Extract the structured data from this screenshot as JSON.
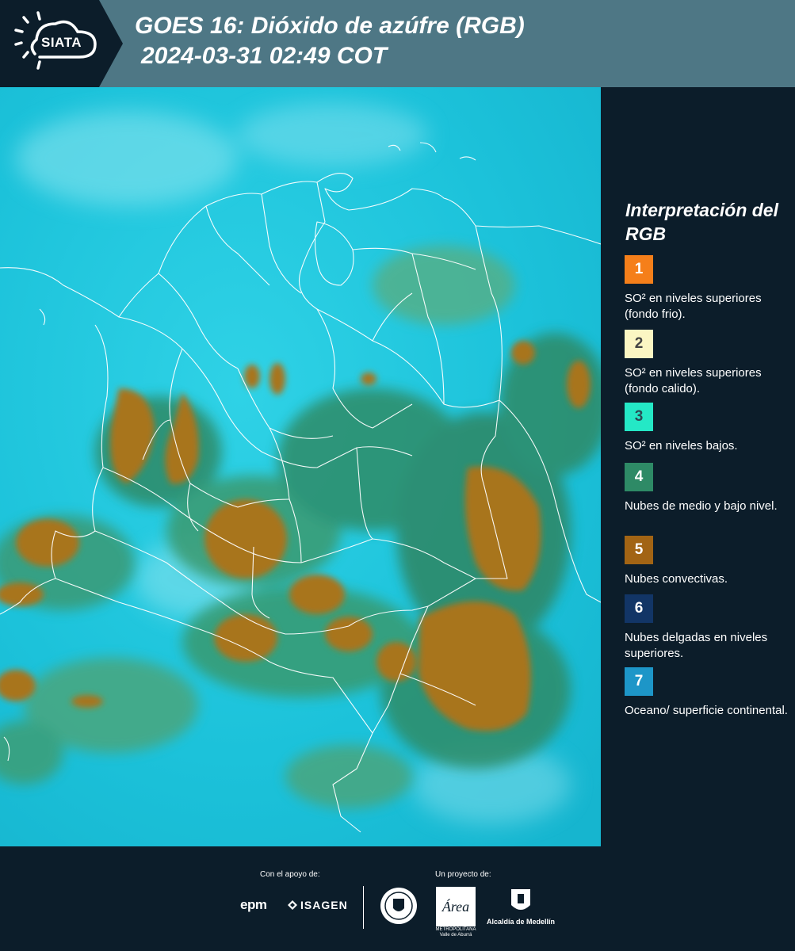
{
  "header": {
    "logo_text": "SIATA",
    "title_line1": "GOES 16: Dióxido de azúfre (RGB)",
    "title_line2": "2024-03-31 02:49 COT"
  },
  "legend": {
    "title": "Interpretación del RGB",
    "items": [
      {
        "number": "1",
        "label": "SO² en niveles superiores (fondo frio).",
        "color": "#f57f1a",
        "text_color": "#ffffff"
      },
      {
        "number": "2",
        "label": "SO² en niveles superiores (fondo calido).",
        "color": "#fbf6c3",
        "text_color": "#444444"
      },
      {
        "number": "3",
        "label": "SO² en niveles bajos.",
        "color": "#24e8c6",
        "text_color": "#2b4a55"
      },
      {
        "number": "4",
        "label": "Nubes de medio y bajo nivel.",
        "color": "#2e8a66",
        "text_color": "#ffffff"
      },
      {
        "number": "5",
        "label": "Nubes convectivas.",
        "color": "#a26414",
        "text_color": "#ffffff"
      },
      {
        "number": "6",
        "label": "Nubes delgadas en niveles superiores.",
        "color": "#123566",
        "text_color": "#ffffff"
      },
      {
        "number": "7",
        "label": "Oceano/ superficie continental.",
        "color": "#1d96c8",
        "text_color": "#ffffff"
      }
    ]
  },
  "footer": {
    "support_label": "Con el apoyo de:",
    "project_label": "Un proyecto de:",
    "epm": "epm",
    "isagen": "ISAGEN",
    "area_logo_text": "Área",
    "area_sub": "METROPOLITANA Valle de Aburrá",
    "alcaldia": "Alcaldía de Medellín"
  },
  "colors": {
    "header_bg": "#4e7785",
    "panel_bg": "#0c1d2a",
    "ocean": "#1fc4dc",
    "convective": "#a8741e",
    "low_cloud": "#2e8a66"
  }
}
